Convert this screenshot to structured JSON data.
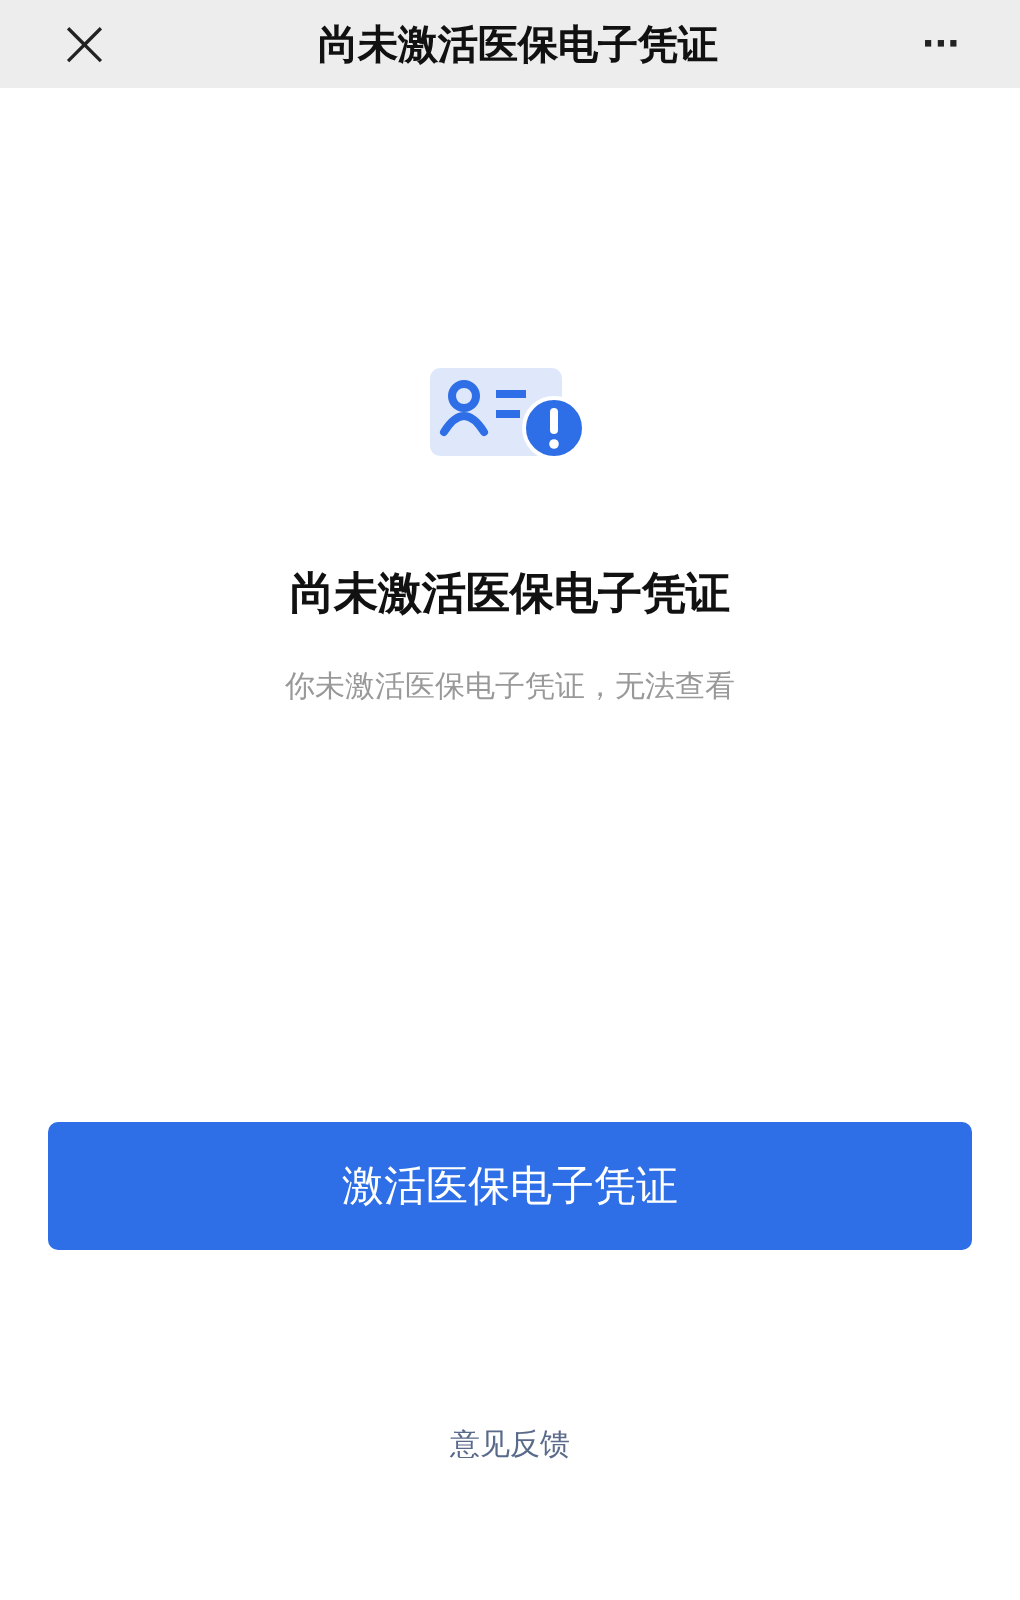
{
  "header": {
    "close": "×",
    "title": "尚未激活医保电子凭证",
    "more": "···"
  },
  "status": {
    "title": "尚未激活医保电子凭证",
    "message": "你未激活医保电子凭证，无法查看"
  },
  "primary_button": "激活医保电子凭证",
  "feedback_link": "意见反馈"
}
